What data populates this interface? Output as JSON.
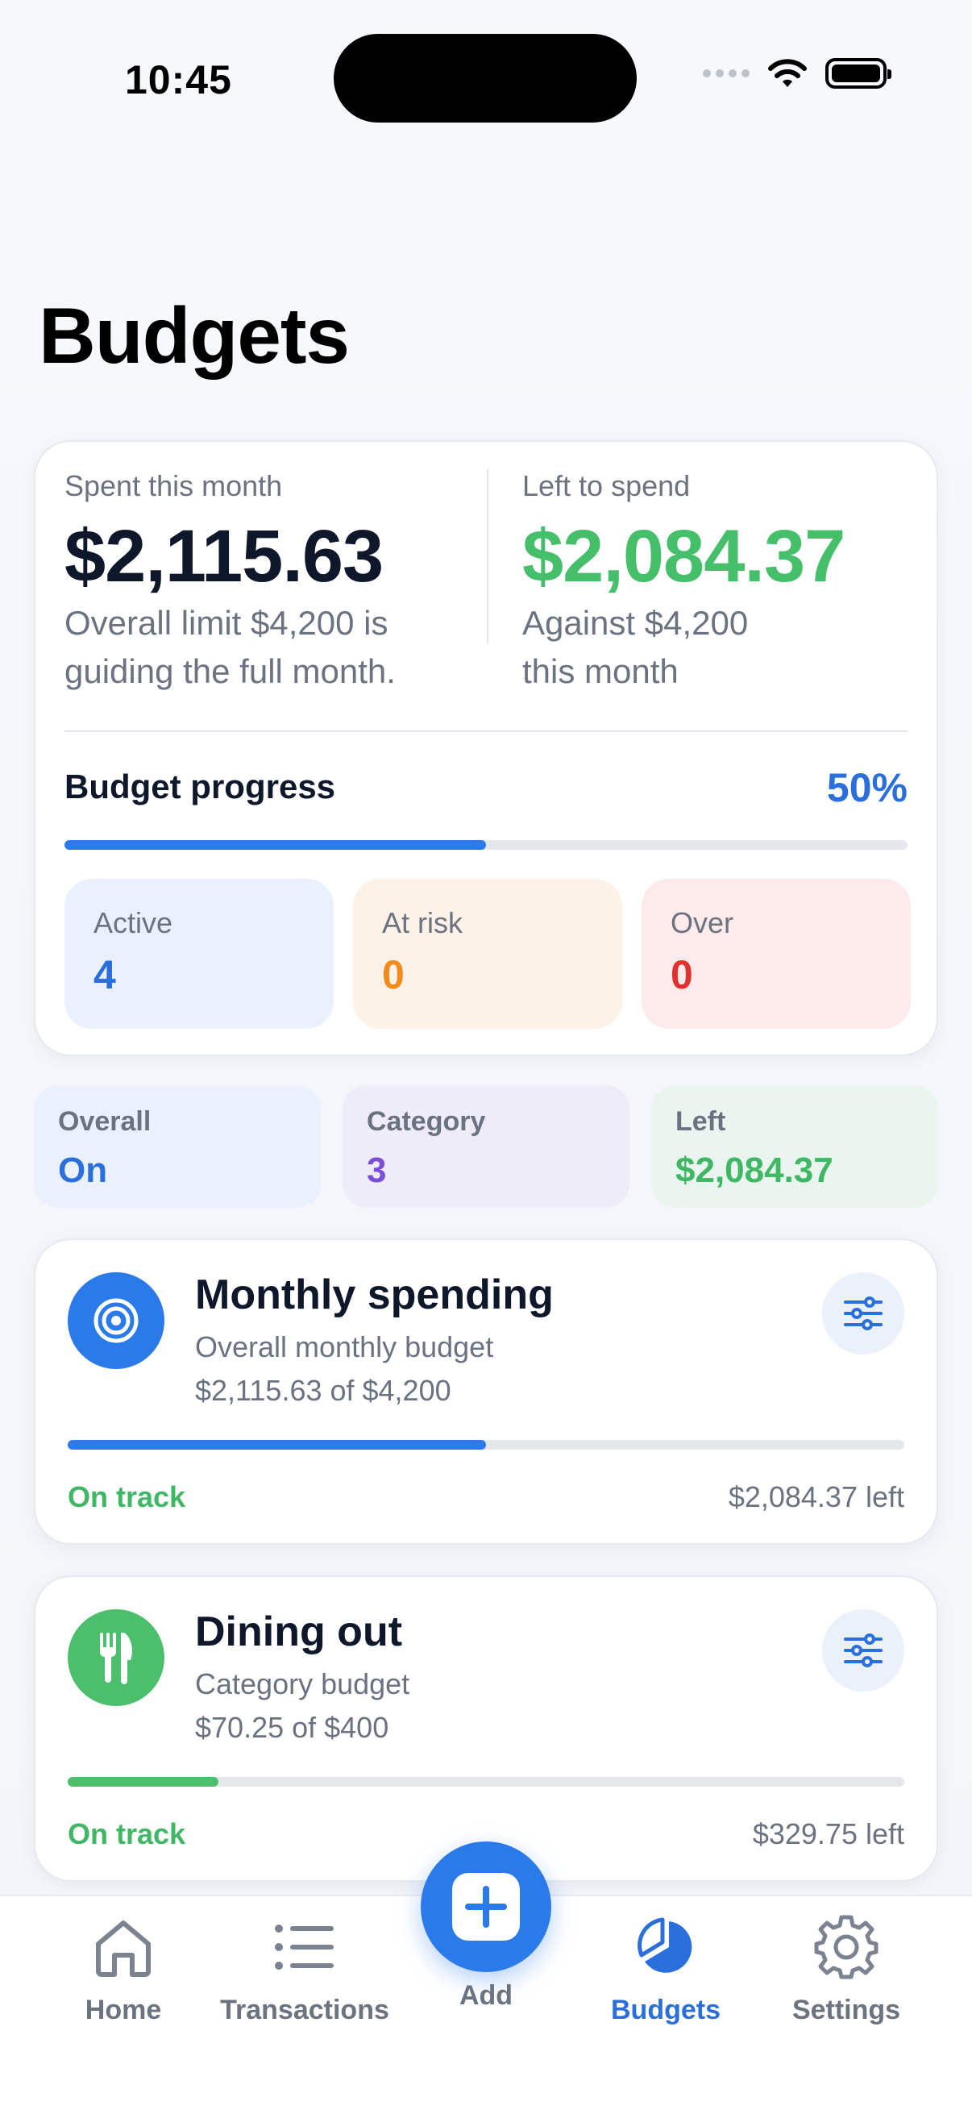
{
  "status": {
    "time": "10:45"
  },
  "page": {
    "title": "Budgets"
  },
  "summary": {
    "spent_label": "Spent this month",
    "spent_value": "$2,115.63",
    "spent_sub_1": "Overall limit $4,200 is",
    "spent_sub_2": "guiding the full month.",
    "left_label": "Left to spend",
    "left_value": "$2,084.37",
    "left_sub_1": "Against $4,200",
    "left_sub_2": "this month",
    "progress_label": "Budget progress",
    "progress_pct": "50%",
    "progress_fraction": 0.5,
    "stats": [
      {
        "label": "Active",
        "value": "4"
      },
      {
        "label": "At risk",
        "value": "0"
      },
      {
        "label": "Over",
        "value": "0"
      }
    ]
  },
  "chips": [
    {
      "label": "Overall",
      "value": "On"
    },
    {
      "label": "Category",
      "value": "3"
    },
    {
      "label": "Left",
      "value": "$2,084.37"
    }
  ],
  "budgets": [
    {
      "icon": "target-icon",
      "title": "Monthly spending",
      "subtitle": "Overall monthly budget",
      "amount": "$2,115.63 of $4,200",
      "progress_fraction": 0.5,
      "status": "On track",
      "left": "$2,084.37 left",
      "color": "#2b7ae9"
    },
    {
      "icon": "fork-knife-icon",
      "title": "Dining out",
      "subtitle": "Category budget",
      "amount": "$70.25 of $400",
      "progress_fraction": 0.18,
      "status": "On track",
      "left": "$329.75 left",
      "color": "#4cbf6d"
    }
  ],
  "tabs": [
    {
      "label": "Home",
      "icon": "home-icon"
    },
    {
      "label": "Transactions",
      "icon": "list-icon"
    },
    {
      "label": "Add",
      "icon": "plus-icon"
    },
    {
      "label": "Budgets",
      "icon": "pie-chart-icon",
      "active": true
    },
    {
      "label": "Settings",
      "icon": "gear-icon"
    }
  ],
  "colors": {
    "accent": "#2a6fdb",
    "green": "#3fb765",
    "orange": "#f28a1c",
    "red": "#e03131",
    "purple": "#7a4fd8"
  }
}
